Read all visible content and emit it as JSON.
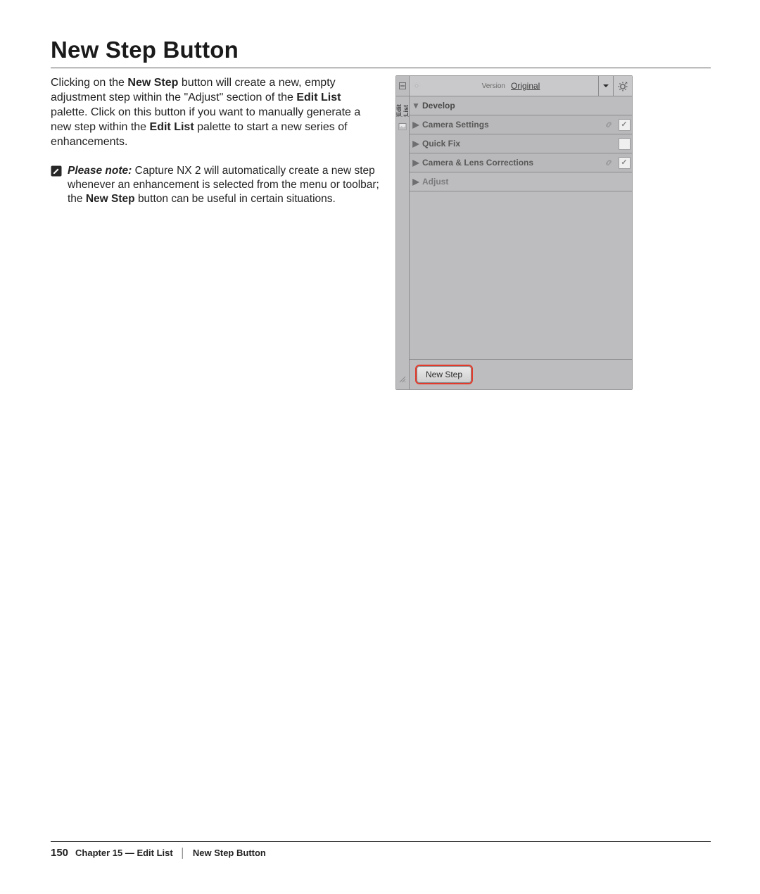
{
  "heading": "New Step Button",
  "paragraph": {
    "t1": "Clicking on the ",
    "b1": "New Step",
    "t2": " button will create a new, empty adjustment step within the \"Adjust\" section of the ",
    "b2": "Edit List",
    "t3": " palette. Click on this button if you want to manually generate a new step within the ",
    "b3": "Edit List",
    "t4": " palette to start a new series of enhancements."
  },
  "note": {
    "lead": "Please note:",
    "body_t1": " Capture NX 2 will automatically create a new step whenever an enhancement is selected from the menu or toolbar; the ",
    "bold": "New Step",
    "body_t2": " button can be useful in certain situations."
  },
  "ui": {
    "side_tab": "Edit List",
    "version_label": "Version",
    "version_value": "Original",
    "develop": "Develop",
    "rows": {
      "camera_settings": "Camera Settings",
      "quick_fix": "Quick Fix",
      "camera_lens": "Camera & Lens Corrections",
      "adjust": "Adjust"
    },
    "new_step_button": "New Step"
  },
  "footer": {
    "page_number": "150",
    "chapter": "Chapter 15 — Edit List",
    "section": "New Step Button"
  }
}
